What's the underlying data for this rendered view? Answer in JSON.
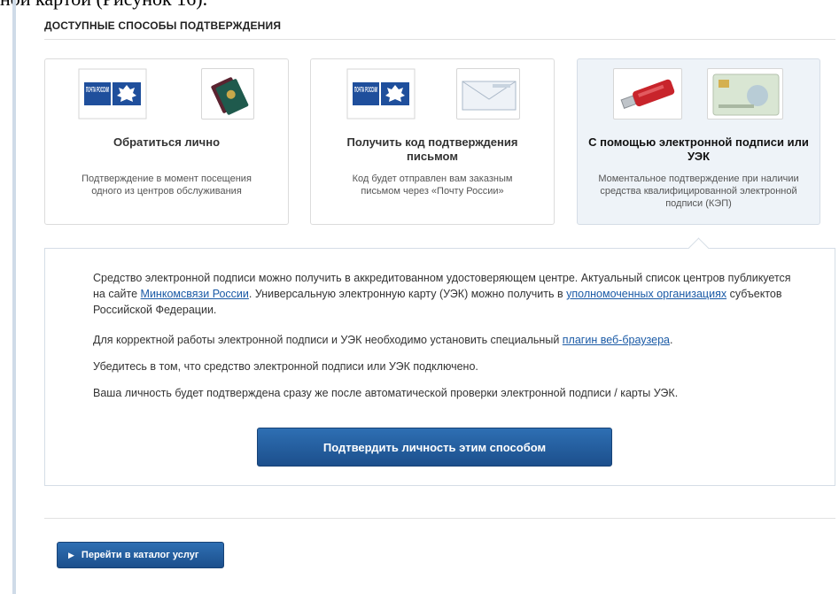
{
  "document": {
    "header_fragment": "ной картой (Рисунок 16)."
  },
  "section": {
    "title": "ДОСТУПНЫЕ СПОСОБЫ ПОДТВЕРЖДЕНИЯ"
  },
  "cards": [
    {
      "logo_text": "ПОЧТА РОССИИ",
      "title": "Обратиться лично",
      "desc": "Подтверждение в момент посещения одного из центров обслуживания"
    },
    {
      "logo_text": "ПОЧТА РОССИИ",
      "title": "Получить код подтверждения письмом",
      "desc": "Код будет отправлен вам заказным письмом через «Почту России»"
    },
    {
      "title": "С помощью электронной подписи или УЭК",
      "desc": "Моментальное подтверждение при наличии средства квалифицированной электронной подписи (КЭП)"
    }
  ],
  "info": {
    "p1_a": "Средство электронной подписи можно получить в аккредитованном удостоверяющем центре. Актуальный список центров публикуется на сайте ",
    "p1_link1": "Минкомсвязи России",
    "p1_b": ". Универсальную электронную карту (УЭК) можно получить в ",
    "p1_link2": "уполномоченных организациях",
    "p1_c": " субъектов Российской Федерации.",
    "p2_a": "Для корректной работы электронной подписи и УЭК необходимо установить специальный ",
    "p2_link": "плагин веб-браузера",
    "p2_b": ".",
    "p3": "Убедитесь в том, что средство электронной подписи или УЭК подключено.",
    "p4": "Ваша личность будет подтверждена сразу же после автоматической проверки электронной подписи / карты УЭК.",
    "confirm_label": "Подтвердить личность этим способом"
  },
  "footer": {
    "catalog_label": "Перейти в каталог услуг"
  },
  "colors": {
    "accent": "#1c4f8c",
    "link": "#1a5aa6",
    "selected_bg": "#eef3f8"
  }
}
